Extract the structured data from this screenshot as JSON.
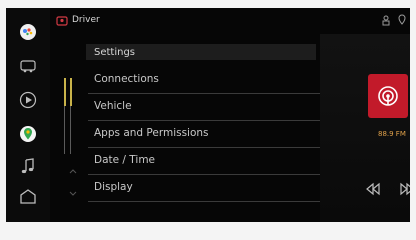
{
  "topbar": {
    "profile_name": "Driver",
    "icons": [
      "profile-icon",
      "user-status-icon",
      "location-icon"
    ]
  },
  "rail": {
    "icons": [
      "assistant-icon",
      "car-icon",
      "play-circle-icon",
      "maps-icon",
      "music-icon",
      "home-icon"
    ]
  },
  "settings": {
    "title": "Settings",
    "items": [
      {
        "label": "Connections"
      },
      {
        "label": "Vehicle"
      },
      {
        "label": "Apps and Permissions"
      },
      {
        "label": "Date / Time"
      },
      {
        "label": "Display"
      }
    ]
  },
  "media": {
    "station": "88.9 FM",
    "icons": [
      "radio-tower-icon",
      "skip-previous-icon",
      "skip-next-icon"
    ]
  },
  "colors": {
    "accent_red": "#c21a2a",
    "accent_gold": "#c9b34a",
    "station_text": "#e0a14a"
  }
}
